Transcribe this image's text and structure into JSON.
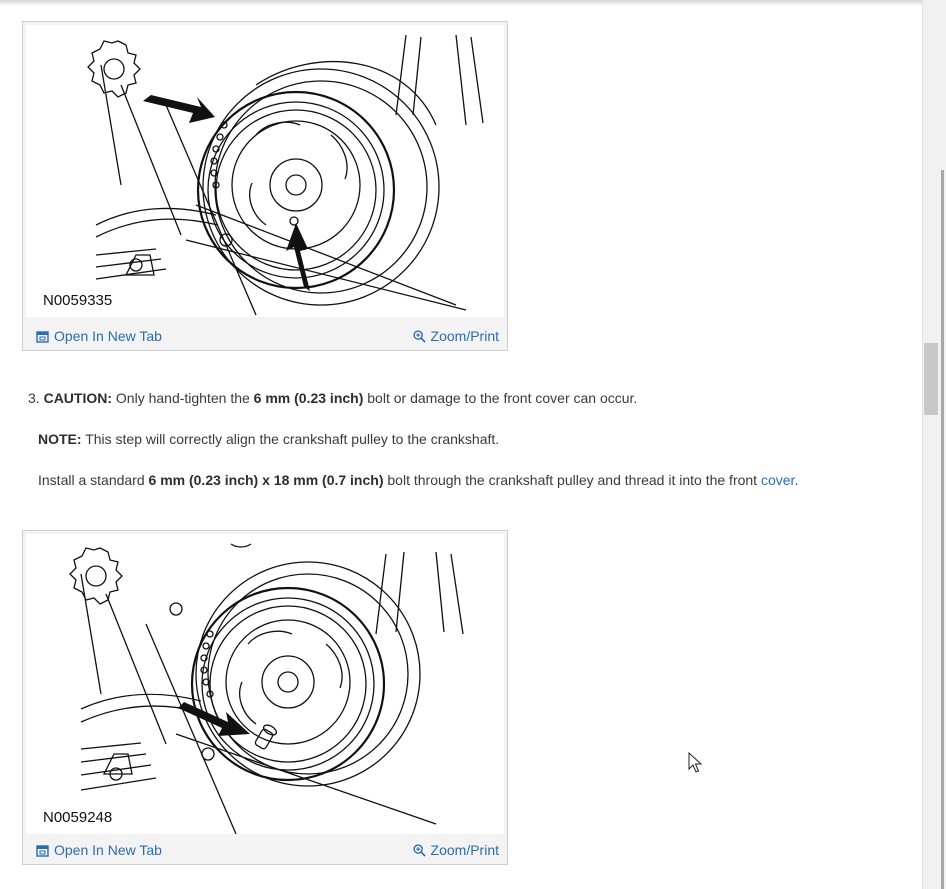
{
  "figures": [
    {
      "id": "N0059335",
      "open_label": "Open In New Tab",
      "zoom_label": "Zoom/Print"
    },
    {
      "id": "N0059248",
      "open_label": "Open In New Tab",
      "zoom_label": "Zoom/Print"
    }
  ],
  "step3": {
    "number": "3.",
    "caution_label": "CAUTION:",
    "caution_pre": "Only hand-tighten the",
    "caution_bold": "6 mm (0.23 inch)",
    "caution_post": "bolt or damage to the front cover can occur.",
    "note_label": "NOTE:",
    "note_text": "This step will correctly align the crankshaft pulley to the crankshaft.",
    "install_pre": "Install a standard",
    "install_bold": "6 mm (0.23 inch) x 18 mm (0.7 inch)",
    "install_mid": "bolt through the crankshaft pulley and thread it into the front",
    "install_link": "cover",
    "install_end": "."
  },
  "icons": {
    "open": "open-new-tab-icon",
    "zoom": "zoom-icon",
    "cursor": "mouse-pointer-icon"
  }
}
